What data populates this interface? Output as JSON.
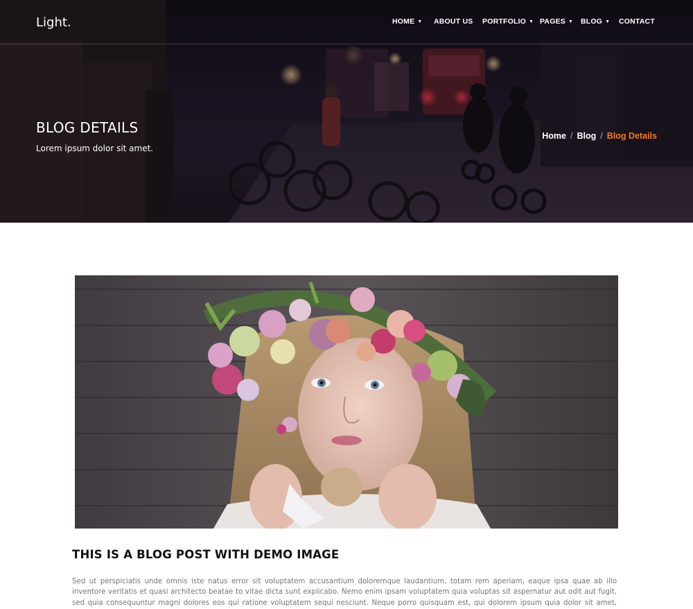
{
  "header": {
    "logo": "Light.",
    "nav": [
      {
        "label": "HOME",
        "has_dropdown": true
      },
      {
        "label": "ABOUT US",
        "has_dropdown": false
      },
      {
        "label": "PORTFOLIO",
        "has_dropdown": true
      },
      {
        "label": "PAGES",
        "has_dropdown": true
      },
      {
        "label": "BLOG",
        "has_dropdown": true
      },
      {
        "label": "CONTACT",
        "has_dropdown": false
      }
    ],
    "dropdown_icon": "caret-down-icon"
  },
  "hero": {
    "title": "BLOG DETAILS",
    "subtitle": "Lorem ipsum dolor sit amet.",
    "breadcrumb": [
      {
        "label": "Home"
      },
      {
        "label": "Blog"
      },
      {
        "label": "Blog Details"
      }
    ],
    "breadcrumb_separator": "/",
    "colors": {
      "accent": "#f27a1a",
      "overlay": "#1a1322"
    }
  },
  "post": {
    "title": "THIS IS A BLOG POST WITH DEMO IMAGE",
    "body": "Sed ut perspiciatis unde omnis iste natus error sit voluptatem accusantium doloremque laudantium, totam rem aperiam, eaque ipsa quae ab illo inventore veritatis et quasi architecto beatae to vitae dicta sunt explicabo. Nemo enim ipsam voluptatem quia voluptas sit aspernatur aut odit aut fugit, sed quia consequuntur magni dolores eos qui ratione voluptatem sequi nesciunt. Neque porro quisquam est, qui dolorem ipsum quia dolor sit amet, consectetur, adipisci velit, sed quia non numquam eius modi tempora"
  }
}
